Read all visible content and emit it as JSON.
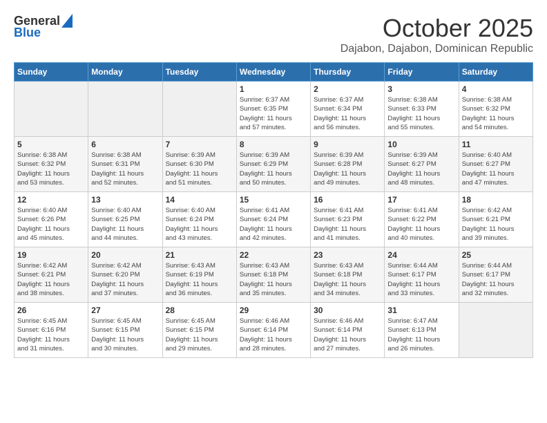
{
  "header": {
    "logo_line1": "General",
    "logo_line2": "Blue",
    "month": "October 2025",
    "location": "Dajabon, Dajabon, Dominican Republic"
  },
  "weekdays": [
    "Sunday",
    "Monday",
    "Tuesday",
    "Wednesday",
    "Thursday",
    "Friday",
    "Saturday"
  ],
  "weeks": [
    [
      {
        "day": "",
        "info": ""
      },
      {
        "day": "",
        "info": ""
      },
      {
        "day": "",
        "info": ""
      },
      {
        "day": "1",
        "info": "Sunrise: 6:37 AM\nSunset: 6:35 PM\nDaylight: 11 hours\nand 57 minutes."
      },
      {
        "day": "2",
        "info": "Sunrise: 6:37 AM\nSunset: 6:34 PM\nDaylight: 11 hours\nand 56 minutes."
      },
      {
        "day": "3",
        "info": "Sunrise: 6:38 AM\nSunset: 6:33 PM\nDaylight: 11 hours\nand 55 minutes."
      },
      {
        "day": "4",
        "info": "Sunrise: 6:38 AM\nSunset: 6:32 PM\nDaylight: 11 hours\nand 54 minutes."
      }
    ],
    [
      {
        "day": "5",
        "info": "Sunrise: 6:38 AM\nSunset: 6:32 PM\nDaylight: 11 hours\nand 53 minutes."
      },
      {
        "day": "6",
        "info": "Sunrise: 6:38 AM\nSunset: 6:31 PM\nDaylight: 11 hours\nand 52 minutes."
      },
      {
        "day": "7",
        "info": "Sunrise: 6:39 AM\nSunset: 6:30 PM\nDaylight: 11 hours\nand 51 minutes."
      },
      {
        "day": "8",
        "info": "Sunrise: 6:39 AM\nSunset: 6:29 PM\nDaylight: 11 hours\nand 50 minutes."
      },
      {
        "day": "9",
        "info": "Sunrise: 6:39 AM\nSunset: 6:28 PM\nDaylight: 11 hours\nand 49 minutes."
      },
      {
        "day": "10",
        "info": "Sunrise: 6:39 AM\nSunset: 6:27 PM\nDaylight: 11 hours\nand 48 minutes."
      },
      {
        "day": "11",
        "info": "Sunrise: 6:40 AM\nSunset: 6:27 PM\nDaylight: 11 hours\nand 47 minutes."
      }
    ],
    [
      {
        "day": "12",
        "info": "Sunrise: 6:40 AM\nSunset: 6:26 PM\nDaylight: 11 hours\nand 45 minutes."
      },
      {
        "day": "13",
        "info": "Sunrise: 6:40 AM\nSunset: 6:25 PM\nDaylight: 11 hours\nand 44 minutes."
      },
      {
        "day": "14",
        "info": "Sunrise: 6:40 AM\nSunset: 6:24 PM\nDaylight: 11 hours\nand 43 minutes."
      },
      {
        "day": "15",
        "info": "Sunrise: 6:41 AM\nSunset: 6:24 PM\nDaylight: 11 hours\nand 42 minutes."
      },
      {
        "day": "16",
        "info": "Sunrise: 6:41 AM\nSunset: 6:23 PM\nDaylight: 11 hours\nand 41 minutes."
      },
      {
        "day": "17",
        "info": "Sunrise: 6:41 AM\nSunset: 6:22 PM\nDaylight: 11 hours\nand 40 minutes."
      },
      {
        "day": "18",
        "info": "Sunrise: 6:42 AM\nSunset: 6:21 PM\nDaylight: 11 hours\nand 39 minutes."
      }
    ],
    [
      {
        "day": "19",
        "info": "Sunrise: 6:42 AM\nSunset: 6:21 PM\nDaylight: 11 hours\nand 38 minutes."
      },
      {
        "day": "20",
        "info": "Sunrise: 6:42 AM\nSunset: 6:20 PM\nDaylight: 11 hours\nand 37 minutes."
      },
      {
        "day": "21",
        "info": "Sunrise: 6:43 AM\nSunset: 6:19 PM\nDaylight: 11 hours\nand 36 minutes."
      },
      {
        "day": "22",
        "info": "Sunrise: 6:43 AM\nSunset: 6:18 PM\nDaylight: 11 hours\nand 35 minutes."
      },
      {
        "day": "23",
        "info": "Sunrise: 6:43 AM\nSunset: 6:18 PM\nDaylight: 11 hours\nand 34 minutes."
      },
      {
        "day": "24",
        "info": "Sunrise: 6:44 AM\nSunset: 6:17 PM\nDaylight: 11 hours\nand 33 minutes."
      },
      {
        "day": "25",
        "info": "Sunrise: 6:44 AM\nSunset: 6:17 PM\nDaylight: 11 hours\nand 32 minutes."
      }
    ],
    [
      {
        "day": "26",
        "info": "Sunrise: 6:45 AM\nSunset: 6:16 PM\nDaylight: 11 hours\nand 31 minutes."
      },
      {
        "day": "27",
        "info": "Sunrise: 6:45 AM\nSunset: 6:15 PM\nDaylight: 11 hours\nand 30 minutes."
      },
      {
        "day": "28",
        "info": "Sunrise: 6:45 AM\nSunset: 6:15 PM\nDaylight: 11 hours\nand 29 minutes."
      },
      {
        "day": "29",
        "info": "Sunrise: 6:46 AM\nSunset: 6:14 PM\nDaylight: 11 hours\nand 28 minutes."
      },
      {
        "day": "30",
        "info": "Sunrise: 6:46 AM\nSunset: 6:14 PM\nDaylight: 11 hours\nand 27 minutes."
      },
      {
        "day": "31",
        "info": "Sunrise: 6:47 AM\nSunset: 6:13 PM\nDaylight: 11 hours\nand 26 minutes."
      },
      {
        "day": "",
        "info": ""
      }
    ]
  ]
}
